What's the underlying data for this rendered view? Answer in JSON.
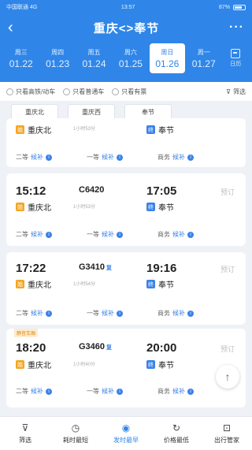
{
  "status": {
    "carrier": "中国联通 4G",
    "time": "13:57",
    "battery": "87%"
  },
  "header": {
    "back": "‹",
    "title": "重庆<>奉节",
    "more": "···"
  },
  "dates": [
    {
      "weekday": "周三",
      "date": "01.22"
    },
    {
      "weekday": "周四",
      "date": "01.23"
    },
    {
      "weekday": "周五",
      "date": "01.24"
    },
    {
      "weekday": "周六",
      "date": "01.25"
    },
    {
      "weekday": "周日",
      "date": "01.26"
    },
    {
      "weekday": "周一",
      "date": "01.27"
    }
  ],
  "calendar_label": "日历",
  "filters": {
    "f1": "只看高铁/动车",
    "f2": "只看普通车",
    "f3": "只看有票",
    "f4": "筛选"
  },
  "stations": [
    "重庆北",
    "重庆西",
    "奉节"
  ],
  "cards": [
    {
      "train": "",
      "dep_time": "",
      "arr_time": "",
      "from": "重庆北",
      "to": "奉节",
      "duration": "1小时53分",
      "book": "",
      "seats": [
        {
          "name": "二等",
          "val": "候补"
        },
        {
          "name": "一等",
          "val": "候补"
        },
        {
          "name": "商务",
          "val": "候补"
        }
      ]
    },
    {
      "train": "C6420",
      "dep_time": "15:12",
      "arr_time": "17:05",
      "from": "重庆北",
      "to": "奉节",
      "duration": "1小时53分",
      "book": "预订",
      "seats": [
        {
          "name": "二等",
          "val": "候补"
        },
        {
          "name": "一等",
          "val": "候补"
        },
        {
          "name": "商务",
          "val": "候补"
        }
      ]
    },
    {
      "train": "G3410",
      "dep_time": "17:22",
      "arr_time": "19:16",
      "from": "重庆北",
      "to": "奉节",
      "duration": "1小时54分",
      "book": "预订",
      "fu": "复",
      "seats": [
        {
          "name": "二等",
          "val": "候补"
        },
        {
          "name": "一等",
          "val": "候补"
        },
        {
          "name": "商务",
          "val": "候补"
        }
      ]
    },
    {
      "badge": "静音车厢",
      "train": "G3460",
      "dep_time": "18:20",
      "arr_time": "20:00",
      "from": "重庆北",
      "to": "奉节",
      "duration": "1小时40分",
      "book": "预订",
      "fu": "复",
      "seats": [
        {
          "name": "二等",
          "val": "候补"
        },
        {
          "name": "一等",
          "val": "候补"
        },
        {
          "name": "商务",
          "val": "候补"
        }
      ]
    }
  ],
  "tabs": [
    {
      "label": "筛选",
      "icon": "filter-icon"
    },
    {
      "label": "耗时最短",
      "icon": "clock-icon"
    },
    {
      "label": "发时最早",
      "icon": "start-time-icon"
    },
    {
      "label": "价格最低",
      "icon": "refresh-icon"
    },
    {
      "label": "出行管家",
      "icon": "cart-icon"
    }
  ],
  "fab": "↑"
}
